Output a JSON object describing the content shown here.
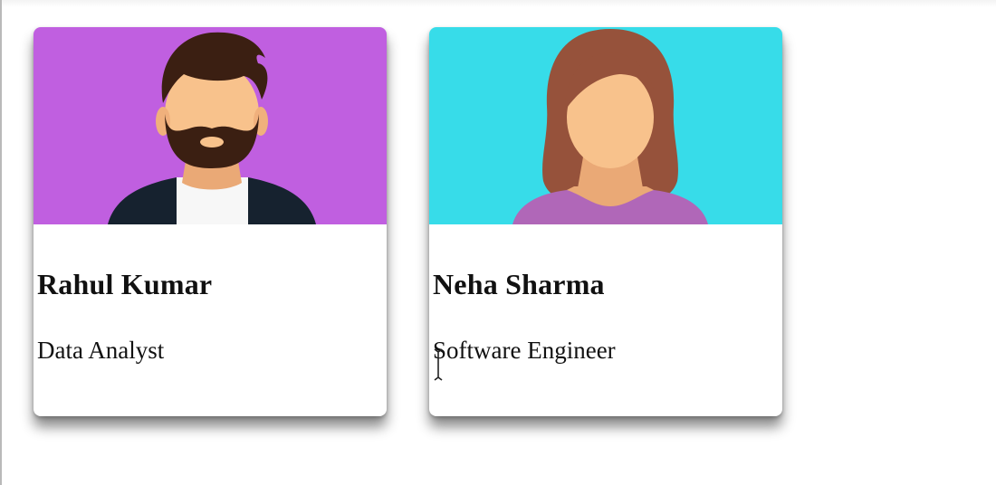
{
  "cards": [
    {
      "name": "Rahul Kumar",
      "role": "Data Analyst",
      "avatar_icon": "man-avatar-icon",
      "background_color": "#c05fe0"
    },
    {
      "name": "Neha Sharma",
      "role": "Software Engineer",
      "avatar_icon": "woman-avatar-icon",
      "background_color": "#37dce9"
    }
  ],
  "colors": {
    "skin": "#f8c28c",
    "male_hair": "#3b1f12",
    "male_jacket": "#16222f",
    "female_hair": "#96523b",
    "female_top": "#b067b8"
  }
}
